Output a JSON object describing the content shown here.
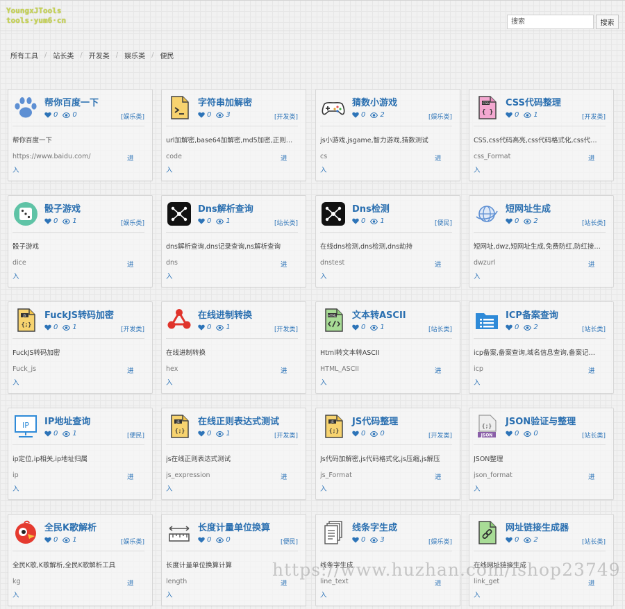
{
  "brand": {
    "line1": "YoungxJTools",
    "line2": "tools·yum6·cn"
  },
  "search": {
    "placeholder": "搜索",
    "button": "搜索"
  },
  "breadcrumb": [
    "所有工具",
    "站长类",
    "开发类",
    "娱乐类",
    "便民"
  ],
  "cards": [
    {
      "title": "帮你百度一下",
      "likes": "0",
      "views": "0",
      "category": "[娱乐类]",
      "desc": "帮你百度一下",
      "slug": "https://www.baidu.com/",
      "enter_a": "进",
      "enter_b": "入",
      "icon": "paw-icon"
    },
    {
      "title": "字符串加解密",
      "likes": "0",
      "views": "3",
      "category": "[开发类]",
      "desc": "url加解密,base64加解密,md5加密,正则…",
      "slug": "code",
      "enter_a": "进",
      "enter_b": "入",
      "icon": "terminal-file-icon"
    },
    {
      "title": "猜数小游戏",
      "likes": "0",
      "views": "2",
      "category": "[娱乐类]",
      "desc": "js小游戏,jsgame,智力游戏,猜数测试",
      "slug": "cs",
      "enter_a": "进",
      "enter_b": "入",
      "icon": "gamepad-icon"
    },
    {
      "title": "CSS代码整理",
      "likes": "0",
      "views": "1",
      "category": "[开发类]",
      "desc": "CSS,css代码高亮,css代码格式化,css代…",
      "slug": "css_Format",
      "enter_a": "进",
      "enter_b": "入",
      "icon": "css-file-icon"
    },
    {
      "title": "骰子游戏",
      "likes": "0",
      "views": "1",
      "category": "[娱乐类]",
      "desc": "骰子游戏",
      "slug": "dice",
      "enter_a": "进",
      "enter_b": "入",
      "icon": "dice-icon"
    },
    {
      "title": "Dns解析查询",
      "likes": "0",
      "views": "1",
      "category": "[站长类]",
      "desc": "dns解析查询,dns记录查询,ns解析查询",
      "slug": "dns",
      "enter_a": "进",
      "enter_b": "入",
      "icon": "network-icon"
    },
    {
      "title": "Dns检测",
      "likes": "0",
      "views": "1",
      "category": "[便民]",
      "desc": "在线dns检测,dns检测,dns劫持",
      "slug": "dnstest",
      "enter_a": "进",
      "enter_b": "入",
      "icon": "network-icon"
    },
    {
      "title": "短网址生成",
      "likes": "0",
      "views": "2",
      "category": "[站长类]",
      "desc": "短网址,dwz,短网址生成,免费防红,防红接…",
      "slug": "dwzurl",
      "enter_a": "进",
      "enter_b": "入",
      "icon": "globe-icon"
    },
    {
      "title": "FuckJS转码加密",
      "likes": "0",
      "views": "1",
      "category": "[开发类]",
      "desc": "FuckJS转码加密",
      "slug": "Fuck_js",
      "enter_a": "进",
      "enter_b": "入",
      "icon": "js-file-icon"
    },
    {
      "title": "在线进制转换",
      "likes": "0",
      "views": "1",
      "category": "[开发类]",
      "desc": "在线进制转换",
      "slug": "hex",
      "enter_a": "进",
      "enter_b": "入",
      "icon": "share-icon"
    },
    {
      "title": "文本转ASCII",
      "likes": "0",
      "views": "1",
      "category": "[站长类]",
      "desc": "Html转文本转ASCII",
      "slug": "HTML_ASCII",
      "enter_a": "进",
      "enter_b": "入",
      "icon": "html-file-icon"
    },
    {
      "title": "ICP备案查询",
      "likes": "0",
      "views": "2",
      "category": "[站长类]",
      "desc": "icp备案,备案查询,域名信息查询,备案记…",
      "slug": "icp",
      "enter_a": "进",
      "enter_b": "入",
      "icon": "list-folder-icon"
    },
    {
      "title": "IP地址查询",
      "likes": "0",
      "views": "1",
      "category": "[便民]",
      "desc": "ip定位,ip相关,ip地址归属",
      "slug": "ip",
      "enter_a": "进",
      "enter_b": "入",
      "icon": "monitor-ip-icon"
    },
    {
      "title": "在线正则表达式测试",
      "likes": "0",
      "views": "1",
      "category": "[开发类]",
      "desc": "js在线正则表达式测试",
      "slug": "js_expression",
      "enter_a": "进",
      "enter_b": "入",
      "icon": "js-file-icon"
    },
    {
      "title": "JS代码整理",
      "likes": "0",
      "views": "0",
      "category": "[开发类]",
      "desc": "Js代码加解密,js代码格式化,js压缩,js解压",
      "slug": "js_Format",
      "enter_a": "进",
      "enter_b": "入",
      "icon": "js-file-icon"
    },
    {
      "title": "JSON验证与整理",
      "likes": "0",
      "views": "0",
      "category": "[站长类]",
      "desc": "JSON整理",
      "slug": "json_format",
      "enter_a": "进",
      "enter_b": "入",
      "icon": "json-file-icon"
    },
    {
      "title": "全民K歌解析",
      "likes": "0",
      "views": "1",
      "category": "[娱乐类]",
      "desc": "全民K歌,K歌解析,全民K歌解析工具",
      "slug": "kg",
      "enter_a": "进",
      "enter_b": "入",
      "icon": "bird-icon"
    },
    {
      "title": "长度计量单位换算",
      "likes": "0",
      "views": "0",
      "category": "[便民]",
      "desc": "长度计量单位换算计算",
      "slug": "length",
      "enter_a": "进",
      "enter_b": "入",
      "icon": "ruler-icon"
    },
    {
      "title": "线条字生成",
      "likes": "0",
      "views": "3",
      "category": "[娱乐类]",
      "desc": "线条字生成",
      "slug": "line_text",
      "enter_a": "进",
      "enter_b": "入",
      "icon": "documents-icon"
    },
    {
      "title": "网址链接生成器",
      "likes": "0",
      "views": "2",
      "category": "[站长类]",
      "desc": "在线网址链接生成",
      "slug": "link_get",
      "enter_a": "进",
      "enter_b": "入",
      "icon": "link-file-icon"
    }
  ],
  "watermark": "https://www.huzhan.com/ishop23749"
}
